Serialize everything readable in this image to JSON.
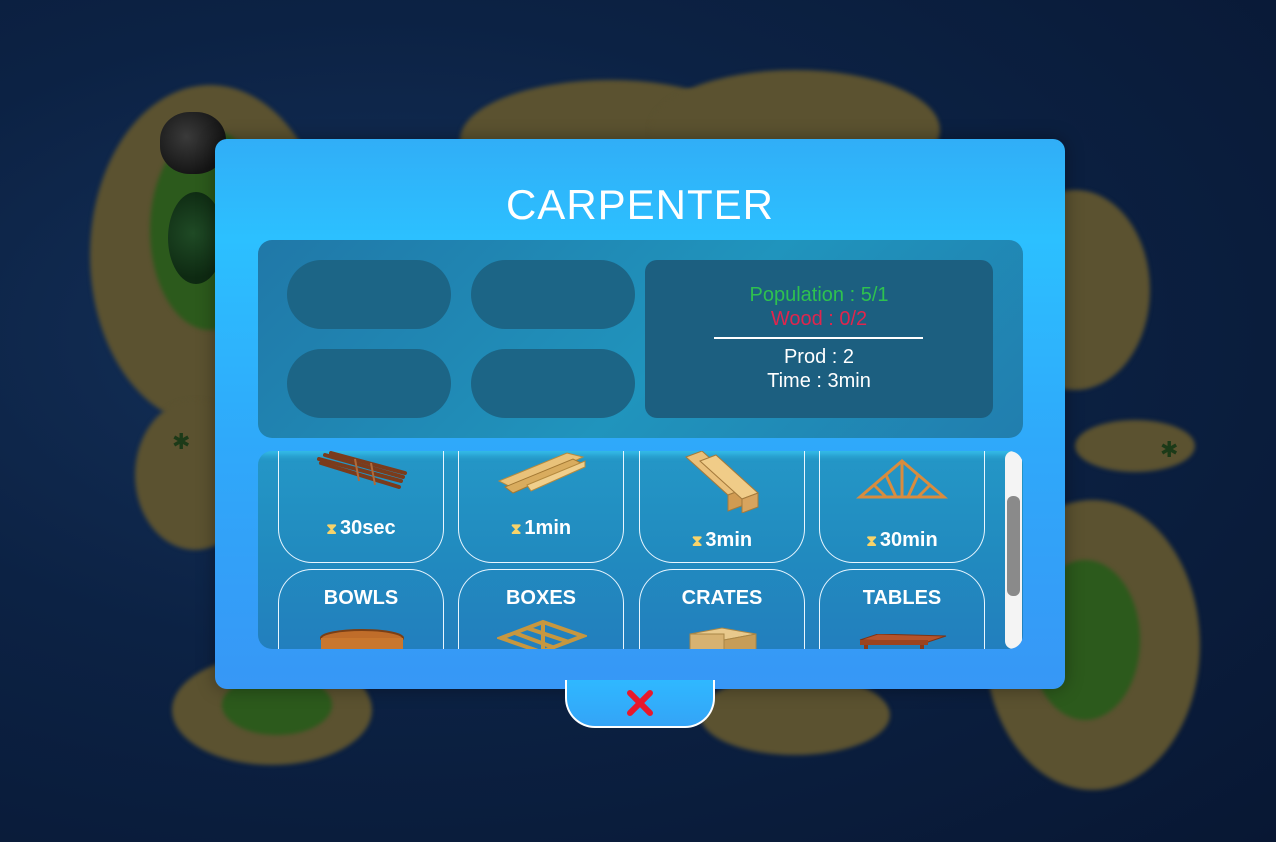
{
  "modal": {
    "title": "CARPENTER"
  },
  "info": {
    "population": "Population : 5/1",
    "wood": "Wood : 0/2",
    "prod": "Prod : 2",
    "time": "Time : 3min",
    "colors": {
      "population": "#2ec14f",
      "wood": "#e0254d"
    }
  },
  "slots": [
    "",
    "",
    "",
    ""
  ],
  "products_row1": [
    {
      "icon": "sticks-icon",
      "time": "30sec"
    },
    {
      "icon": "planks-icon",
      "time": "1min"
    },
    {
      "icon": "beams-icon",
      "time": "3min"
    },
    {
      "icon": "truss-icon",
      "time": "30min"
    }
  ],
  "products_row2": [
    {
      "name": "BOWLS",
      "icon": "bowl-icon"
    },
    {
      "name": "BOXES",
      "icon": "box-icon"
    },
    {
      "name": "CRATES",
      "icon": "crate-icon"
    },
    {
      "name": "TABLES",
      "icon": "table-icon"
    }
  ],
  "close": {
    "icon": "close-icon",
    "color": "#e8182c"
  }
}
